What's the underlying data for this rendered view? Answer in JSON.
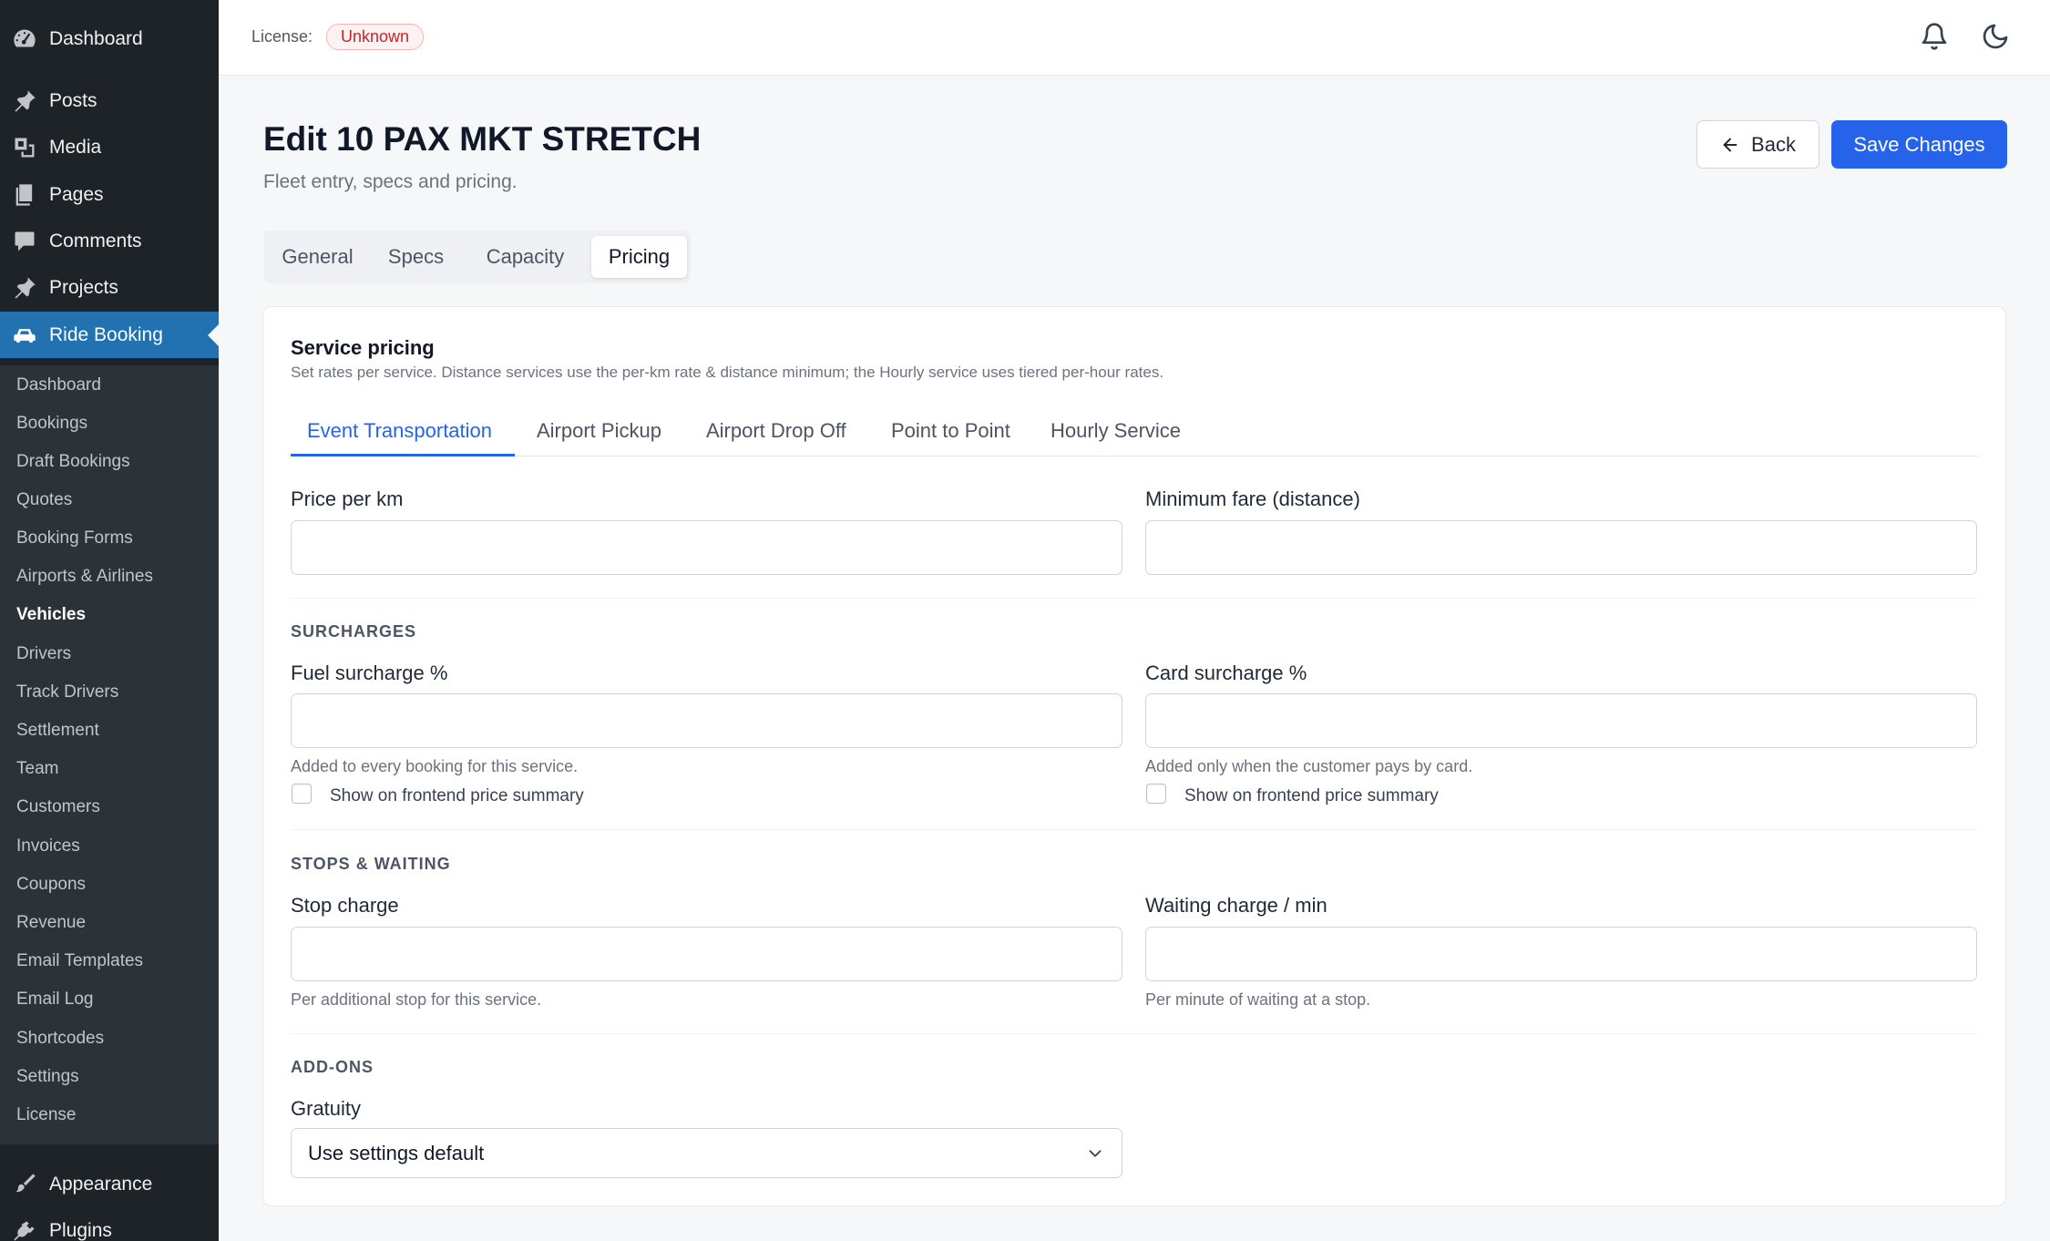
{
  "sidebar": {
    "top_items": [
      {
        "label": "Dashboard",
        "icon": "dashboard-icon"
      },
      {
        "label": "Posts",
        "icon": "pin-icon"
      },
      {
        "label": "Media",
        "icon": "media-icon"
      },
      {
        "label": "Pages",
        "icon": "pages-icon"
      },
      {
        "label": "Comments",
        "icon": "comment-icon"
      },
      {
        "label": "Projects",
        "icon": "pin-icon"
      },
      {
        "label": "Ride Booking",
        "icon": "car-icon"
      }
    ],
    "submenu": [
      "Dashboard",
      "Bookings",
      "Draft Bookings",
      "Quotes",
      "Booking Forms",
      "Airports & Airlines",
      "Vehicles",
      "Drivers",
      "Track Drivers",
      "Settlement",
      "Team",
      "Customers",
      "Invoices",
      "Coupons",
      "Revenue",
      "Email Templates",
      "Email Log",
      "Shortcodes",
      "Settings",
      "License"
    ],
    "current_submenu": "Vehicles",
    "bottom_items": [
      {
        "label": "Appearance",
        "icon": "brush-icon"
      },
      {
        "label": "Plugins",
        "icon": "plug-icon"
      }
    ]
  },
  "topbar": {
    "license_label": "License:",
    "license_status": "Unknown",
    "icons": [
      "bell-icon",
      "moon-icon"
    ]
  },
  "header": {
    "title": "Edit 10 PAX MKT STRETCH",
    "subtitle": "Fleet entry, specs and pricing.",
    "back_label": "Back",
    "save_label": "Save Changes"
  },
  "tabs": [
    "General",
    "Specs",
    "Capacity",
    "Pricing"
  ],
  "active_tab": "Pricing",
  "pricing": {
    "section_title": "Service pricing",
    "section_desc": "Set rates per service. Distance services use the per-km rate & distance minimum; the Hourly service uses tiered per-hour rates.",
    "service_tabs": [
      "Event Transportation",
      "Airport Pickup",
      "Airport Drop Off",
      "Point to Point",
      "Hourly Service"
    ],
    "active_service": "Event Transportation",
    "price_per_km": {
      "label": "Price per km",
      "value": ""
    },
    "minimum_fare": {
      "label": "Minimum fare (distance)",
      "value": ""
    },
    "surcharges": {
      "heading": "SURCHARGES",
      "fuel": {
        "label": "Fuel surcharge %",
        "value": "",
        "help": "Added to every booking for this service.",
        "show_label": "Show on frontend price summary",
        "checked": false
      },
      "card": {
        "label": "Card surcharge %",
        "value": "",
        "help": "Added only when the customer pays by card.",
        "show_label": "Show on frontend price summary",
        "checked": false
      }
    },
    "stops": {
      "heading": "STOPS & WAITING",
      "stop_charge": {
        "label": "Stop charge",
        "value": "",
        "help": "Per additional stop for this service."
      },
      "waiting_charge": {
        "label": "Waiting charge / min",
        "value": "",
        "help": "Per minute of waiting at a stop."
      }
    },
    "addons": {
      "heading": "ADD-ONS",
      "gratuity": {
        "label": "Gratuity",
        "selected": "Use settings default"
      }
    }
  },
  "colors": {
    "sidebar_bg": "#1d2327",
    "active_menu": "#2271b1",
    "primary": "#2563eb",
    "badge_red": "#c0262d"
  }
}
